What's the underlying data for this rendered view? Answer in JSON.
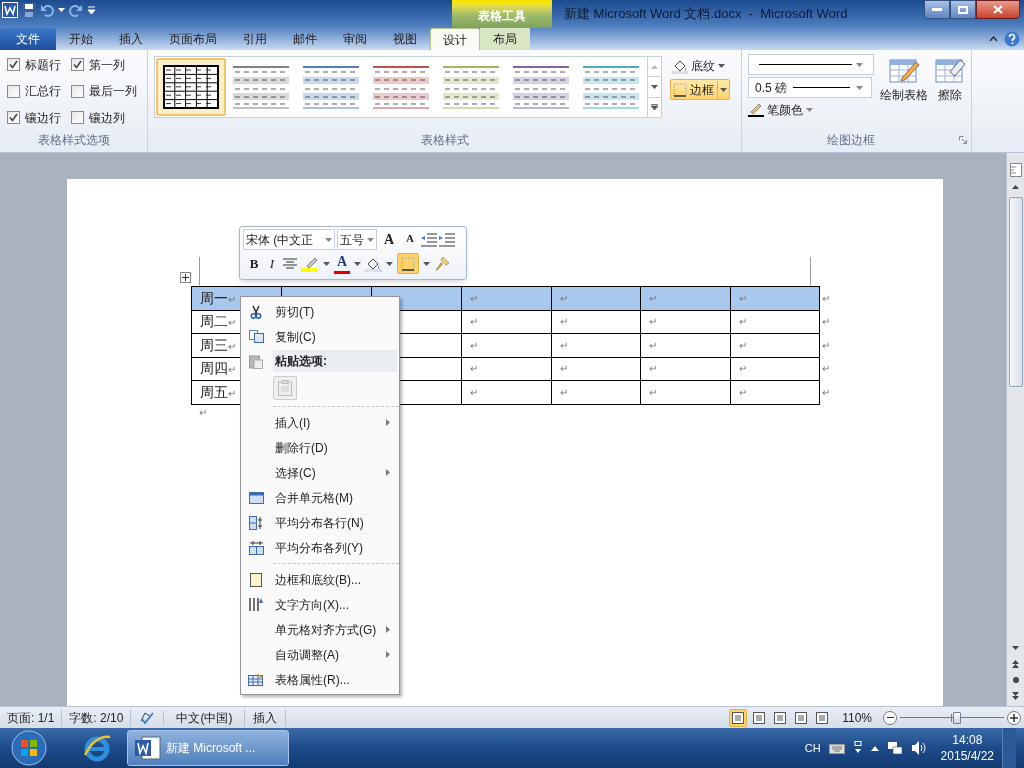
{
  "title_bar": {
    "context_group": "表格工具",
    "title": "新建 Microsoft Word 文档.docx  -  Microsoft Word"
  },
  "tabs": [
    {
      "label": "文件",
      "kind": "file",
      "selected": false
    },
    {
      "label": "开始",
      "kind": "normal",
      "selected": false
    },
    {
      "label": "插入",
      "kind": "normal",
      "selected": false
    },
    {
      "label": "页面布局",
      "kind": "normal",
      "selected": false
    },
    {
      "label": "引用",
      "kind": "normal",
      "selected": false
    },
    {
      "label": "邮件",
      "kind": "normal",
      "selected": false
    },
    {
      "label": "审阅",
      "kind": "normal",
      "selected": false
    },
    {
      "label": "视图",
      "kind": "normal",
      "selected": false
    },
    {
      "label": "设计",
      "kind": "context",
      "selected": true
    },
    {
      "label": "布局",
      "kind": "context",
      "selected": false
    }
  ],
  "style_options": {
    "title": "表格样式选项",
    "options": [
      {
        "label": "标题行",
        "checked": true
      },
      {
        "label": "第一列",
        "checked": true
      },
      {
        "label": "汇总行",
        "checked": false
      },
      {
        "label": "最后一列",
        "checked": false
      },
      {
        "label": "镶边行",
        "checked": true
      },
      {
        "label": "镶边列",
        "checked": false
      }
    ]
  },
  "table_styles": {
    "title": "表格样式",
    "gallery": [
      {
        "kind": "grid",
        "color": "#000000",
        "selected": true
      },
      {
        "kind": "banded",
        "color": "#808080",
        "selected": false
      },
      {
        "kind": "banded",
        "color": "#4f81bd",
        "selected": false
      },
      {
        "kind": "banded",
        "color": "#c0504d",
        "selected": false
      },
      {
        "kind": "banded",
        "color": "#9bbb59",
        "selected": false
      },
      {
        "kind": "banded",
        "color": "#8064a2",
        "selected": false
      },
      {
        "kind": "banded",
        "color": "#4bacc6",
        "selected": false
      }
    ],
    "shading": "底纹",
    "borders": {
      "label": "边框",
      "active": true
    }
  },
  "draw_borders": {
    "title": "绘图边框",
    "line_weight": "0.5 磅",
    "pen_color": "笔颜色",
    "draw_table": "绘制表格",
    "eraser": "擦除"
  },
  "mini_toolbar": {
    "font": "宋体 (中文正",
    "size": "五号",
    "grow_font": "A",
    "shrink_font": "A",
    "bold": "B",
    "italic": "I",
    "font_color": "A",
    "border_active": true
  },
  "table": {
    "rows": [
      {
        "selected": true,
        "first_cell": {
          "text": "周一",
          "mark": "↵"
        },
        "visible_cells": [
          "↵",
          "↵",
          "↵",
          "↵"
        ],
        "end_mark": "↵"
      },
      {
        "selected": false,
        "first_cell": {
          "text": "周二",
          "mark": "↵"
        },
        "visible_cells": [
          "↵",
          "↵",
          "↵",
          "↵"
        ],
        "end_mark": "↵"
      },
      {
        "selected": false,
        "first_cell": {
          "text": "周三",
          "mark": "↵"
        },
        "visible_cells": [
          "↵",
          "↵",
          "↵",
          "↵"
        ],
        "end_mark": "↵"
      },
      {
        "selected": false,
        "first_cell": {
          "text": "周四",
          "mark": "↵"
        },
        "visible_cells": [
          "↵",
          "↵",
          "↵",
          "↵"
        ],
        "end_mark": "↵"
      },
      {
        "selected": false,
        "first_cell": {
          "text": "周五",
          "mark": "↵"
        },
        "visible_cells": [
          "↵",
          "↵",
          "↵",
          "↵"
        ],
        "end_mark": "↵"
      }
    ],
    "paragraph_mark": "↵"
  },
  "context_menu": {
    "items": [
      {
        "kind": "item",
        "label": "剪切(T)",
        "submenu": false
      },
      {
        "kind": "item",
        "label": "复制(C)",
        "submenu": false
      },
      {
        "kind": "header",
        "label": "粘贴选项:"
      },
      {
        "kind": "paste"
      },
      {
        "kind": "separator"
      },
      {
        "kind": "item",
        "label": "插入(I)",
        "submenu": true
      },
      {
        "kind": "item",
        "label": "删除行(D)",
        "submenu": false
      },
      {
        "kind": "item",
        "label": "选择(C)",
        "submenu": true
      },
      {
        "kind": "item",
        "label": "合并单元格(M)",
        "submenu": false
      },
      {
        "kind": "item",
        "label": "平均分布各行(N)",
        "submenu": false
      },
      {
        "kind": "item",
        "label": "平均分布各列(Y)",
        "submenu": false
      },
      {
        "kind": "separator"
      },
      {
        "kind": "item",
        "label": "边框和底纹(B)...",
        "submenu": false
      },
      {
        "kind": "item",
        "label": "文字方向(X)...",
        "submenu": false
      },
      {
        "kind": "item",
        "label": "单元格对齐方式(G)",
        "submenu": true
      },
      {
        "kind": "item",
        "label": "自动调整(A)",
        "submenu": true
      },
      {
        "kind": "item",
        "label": "表格属性(R)...",
        "submenu": false
      }
    ]
  },
  "status_bar": {
    "page": "页面: 1/1",
    "words": "字数: 2/10",
    "language": "中文(中国)",
    "mode": "插入",
    "views": [
      {
        "selected": true
      },
      {
        "selected": false
      },
      {
        "selected": false
      },
      {
        "selected": false
      },
      {
        "selected": false
      }
    ],
    "zoom": "110%",
    "zoom_slider": {
      "level": 0.55
    }
  },
  "taskbar": {
    "task": "新建 Microsoft ...",
    "ime": "CH",
    "time": "14:08",
    "date": "2015/4/22"
  }
}
